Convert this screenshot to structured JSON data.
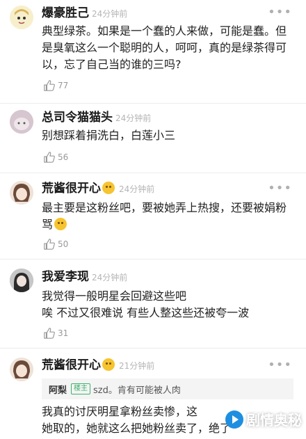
{
  "comments": [
    {
      "name": "爆豪胜己",
      "time": "24分钟前",
      "text": "典型绿茶。如果是一个蠢的人来做，可能是蠢。但是臭氧这么一个聪明的人，呵呵，真的是绿茶得可以，忘了自己当的谁的三吗?",
      "likes": "77"
    },
    {
      "name": "总司令猫猫头",
      "time": "24分钟前",
      "text": "别想踩着捐洗白，白莲小三",
      "likes": "56"
    },
    {
      "name": "荒酱很开心",
      "time": "24分钟前",
      "text": "最主要是这粉丝吧，要被她弄上热搜，还要被娟粉骂",
      "likes": "50"
    },
    {
      "name": "我爱李现",
      "time": "24分钟前",
      "text_line1": "我觉得一般明星会回避这些吧",
      "text_line2": "唉  不过又很难说  有些人整这些还被夸一波",
      "likes": "31"
    },
    {
      "name": "荒酱很开心",
      "time": "21分钟前",
      "quote_name": "阿梨",
      "quote_badge": "楼主",
      "quote_text": "szd。肯有可能被人肉",
      "text_line1": "我真的讨厌明星拿粉丝卖惨，这",
      "text_line2": "她取的，她就这么把她粉丝卖了，绝了"
    }
  ],
  "more_glyph": "•••",
  "watermark": "剧情奥秘",
  "colors": {
    "time": "#b5b5b5",
    "like": "#999999",
    "badge": "#3bb36b",
    "watermark_circle": "#1e8fe0"
  }
}
